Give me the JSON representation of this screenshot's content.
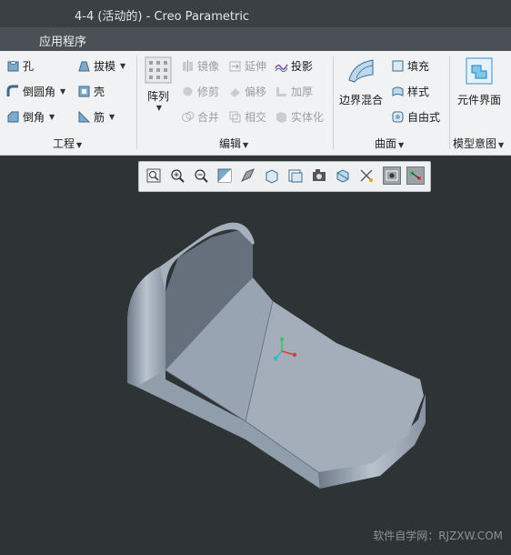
{
  "window": {
    "title": "4-4 (活动的) - Creo Parametric"
  },
  "menubar": {
    "tab_label": "应用程序"
  },
  "ribbon": {
    "engineering": {
      "label": "工程",
      "hole": "孔",
      "draft": "拔模",
      "round": "倒圆角",
      "shell": "壳",
      "chamfer": "倒角",
      "rib": "筋"
    },
    "editing": {
      "label": "编辑",
      "pattern": "阵列",
      "mirror": "镜像",
      "extend": "延伸",
      "project": "投影",
      "trim": "修剪",
      "offset": "偏移",
      "thicken": "加厚",
      "merge": "合并",
      "intersect": "相交",
      "solidify": "实体化"
    },
    "surfaces": {
      "label": "曲面",
      "boundary_blend": "边界混合",
      "fill": "填充",
      "style": "样式",
      "freestyle": "自由式"
    },
    "model_intent": {
      "label": "模型意图",
      "component_interface": "元件界面"
    }
  },
  "view_toolbar": {
    "icons": [
      "refit-icon",
      "zoom-in-icon",
      "zoom-out-icon",
      "repaint-icon",
      "display-style-icon",
      "saved-orientations-icon",
      "view-manager-icon",
      "perspective-icon",
      "section-icon",
      "datum-display-icon",
      "spin-center-icon",
      "annotation-display-icon"
    ]
  },
  "watermark": "软件自学网：RJZXW.COM",
  "colors": {
    "titlebar": "#3b4044",
    "menubar": "#4a5055",
    "ribbon": "#f0f2f3",
    "viewport": "#2e3335",
    "model": "#9aa6b4"
  }
}
